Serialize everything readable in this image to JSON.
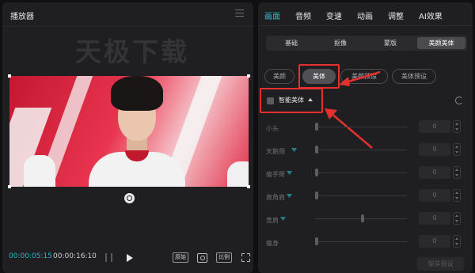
{
  "player": {
    "title": "播放器",
    "watermark": "天极下载",
    "current_time": "00:00:05:15",
    "total_time": "00:00:16:10",
    "ratio_label": "原始",
    "aspect_label": "比例"
  },
  "props": {
    "tabs": [
      {
        "label": "画面",
        "active": true
      },
      {
        "label": "音频",
        "active": false
      },
      {
        "label": "变速",
        "active": false
      },
      {
        "label": "动画",
        "active": false
      },
      {
        "label": "调整",
        "active": false
      },
      {
        "label": "AI效果",
        "active": false
      }
    ],
    "subtabs": [
      {
        "label": "基础",
        "active": false
      },
      {
        "label": "抠像",
        "active": false
      },
      {
        "label": "蒙版",
        "active": false
      },
      {
        "label": "美颜美体",
        "active": true
      }
    ],
    "pills": [
      {
        "label": "美颜",
        "active": false
      },
      {
        "label": "美体",
        "active": true
      },
      {
        "label": "美颜预设",
        "active": false
      },
      {
        "label": "美体预设",
        "active": false
      }
    ],
    "section_title": "智能美体",
    "sliders": [
      {
        "label": "小头",
        "vip": false,
        "value": "0",
        "level": 0
      },
      {
        "label": "天鹅颈",
        "vip": true,
        "value": "0",
        "level": 0
      },
      {
        "label": "瘦手臂",
        "vip": true,
        "value": "0",
        "level": 0
      },
      {
        "label": "直角肩",
        "vip": true,
        "value": "0",
        "level": 0
      },
      {
        "label": "宽肩",
        "vip": true,
        "value": "0",
        "level": 0.5
      },
      {
        "label": "瘦身",
        "vip": false,
        "value": "0",
        "level": 0
      }
    ],
    "save_label": "保存预设"
  },
  "colors": {
    "accent": "#2dc2d1",
    "highlight": "#e5302f",
    "panel": "#1f1f22"
  }
}
